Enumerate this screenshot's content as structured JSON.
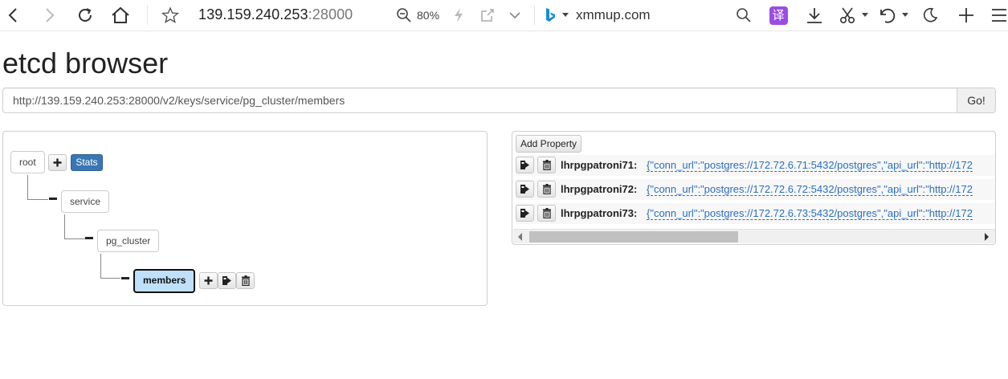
{
  "browser": {
    "address_host": "139.159.240.253",
    "address_port": ":28000",
    "zoom": "80%",
    "search_engine_text": "xmmup.com",
    "translate_label": "译",
    "icons": [
      "back-icon",
      "forward-icon",
      "reload-icon",
      "home-icon",
      "star-icon",
      "zoom-out-icon",
      "lightning-icon",
      "share-icon",
      "chevron-down-icon",
      "bing-icon",
      "search-icon",
      "translate-icon",
      "download-icon",
      "scissors-icon",
      "undo-icon",
      "moon-icon",
      "plus-icon",
      "menu-icon"
    ]
  },
  "page": {
    "title": "etcd browser",
    "url_value": "http://139.159.240.253:28000/v2/keys/service/pg_cluster/members",
    "go_label": "Go!"
  },
  "tree": {
    "root_label": "root",
    "stats_label": "Stats",
    "service_label": "service",
    "pg_cluster_label": "pg_cluster",
    "members_label": "members"
  },
  "properties": {
    "add_label": "Add Property",
    "rows": [
      {
        "key": "lhrpgpatroni71:",
        "value": "{\"conn_url\":\"postgres://172.72.6.71:5432/postgres\",\"api_url\":\"http://172"
      },
      {
        "key": "lhrpgpatroni72:",
        "value": "{\"conn_url\":\"postgres://172.72.6.72:5432/postgres\",\"api_url\":\"http://172"
      },
      {
        "key": "lhrpgpatroni73:",
        "value": "{\"conn_url\":\"postgres://172.72.6.73:5432/postgres\",\"api_url\":\"http://172"
      }
    ]
  },
  "colors": {
    "stats_button": "#3a76b3",
    "selected_node": "#bfe0fb",
    "link_value": "#2a6fc0",
    "translate_button": "#9b4de2"
  }
}
